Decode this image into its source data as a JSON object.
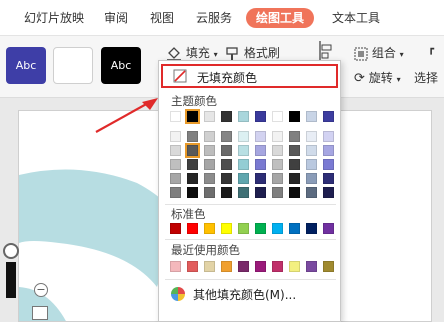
{
  "menu": {
    "tabs": [
      {
        "label": "幻灯片放映"
      },
      {
        "label": "审阅"
      },
      {
        "label": "视图"
      },
      {
        "label": "云服务"
      },
      {
        "label": "绘图工具"
      },
      {
        "label": "文本工具"
      }
    ],
    "active_tab": "绘图工具",
    "accent": "#f0745a"
  },
  "ribbon": {
    "styles": [
      {
        "label": "Abc",
        "bg": "#3e3ea7",
        "fg": "#ffffff"
      },
      {
        "label": "",
        "bg": "#ffffff",
        "fg": "#333333"
      },
      {
        "label": "Abc",
        "bg": "#000000",
        "fg": "#ffffff"
      }
    ],
    "fill_label": "填充",
    "fill_icon": "paint-bucket-icon",
    "format_brush_label": "格式刷",
    "format_brush_icon": "format-brush-icon",
    "group_label": "组合",
    "rotate_label": "旋转",
    "select_label": "选择"
  },
  "dropdown": {
    "no_fill_label": "无填充颜色",
    "theme_label": "主题颜色",
    "standard_label": "标准色",
    "recent_label": "最近使用颜色",
    "more_label": "其他填充颜色(M)...",
    "theme_top": [
      "#ffffff",
      "#000000",
      "#e6e6e6",
      "#333333",
      "#a9d6dc",
      "#3a3a9c",
      "#ffffff",
      "#000000",
      "#c8d4e6",
      "#3d3da0"
    ],
    "theme_shades": [
      [
        "#f2f2f2",
        "#808080",
        "#d0d0d0",
        "#858585",
        "#dcefF1",
        "#d2d2f0",
        "#f2f2f2",
        "#808080",
        "#e8edf5",
        "#d2d2f2"
      ],
      [
        "#d9d9d9",
        "#595959",
        "#bdbdbd",
        "#6a6a6a",
        "#b8dfe3",
        "#a6a6e0",
        "#d9d9d9",
        "#595959",
        "#d0dbea",
        "#a6a6e2"
      ],
      [
        "#bfbfbf",
        "#404040",
        "#a6a6a6",
        "#4f4f4f",
        "#93cdd4",
        "#7979d1",
        "#bfbfbf",
        "#404040",
        "#b9c8df",
        "#7a7ad3"
      ],
      [
        "#a6a6a6",
        "#262626",
        "#8c8c8c",
        "#353535",
        "#5fa6ae",
        "#2d2d75",
        "#a6a6a6",
        "#262626",
        "#8a9cb8",
        "#2e2e77"
      ],
      [
        "#7f7f7f",
        "#0d0d0d",
        "#6e6e6e",
        "#1a1a1a",
        "#3f7075",
        "#1e1e4e",
        "#7f7f7f",
        "#0d0d0d",
        "#5c6b80",
        "#1f1f50"
      ]
    ],
    "standard": [
      "#c00000",
      "#ff0000",
      "#ffc000",
      "#ffff00",
      "#92d050",
      "#00b050",
      "#00b0f0",
      "#0070c0",
      "#002060",
      "#7030a0"
    ],
    "recent": [
      "#f4b8bc",
      "#e25c5c",
      "#e2d3a6",
      "#f0a030",
      "#7a2a6a",
      "#9a1a7a",
      "#c0306a",
      "#f3f080",
      "#7a4aa0",
      "#a08a30"
    ],
    "selected_theme_color": "#000000"
  },
  "colors": {
    "highlight_border": "#e02a2a",
    "arrow": "#e02a2a",
    "flower": "#b7dde2"
  }
}
